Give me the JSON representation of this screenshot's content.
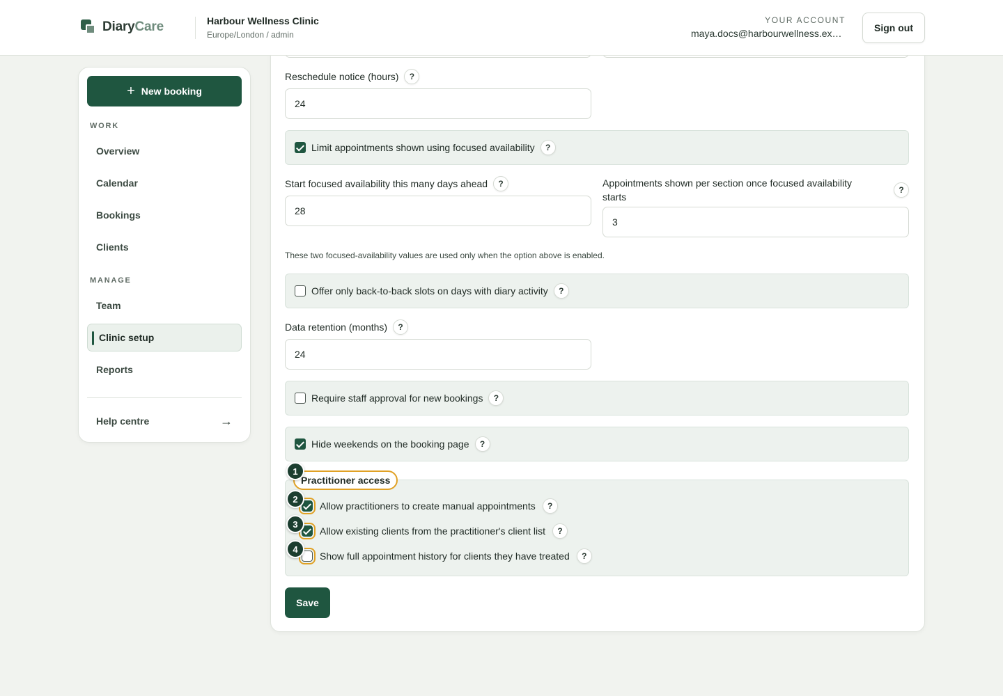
{
  "app": {
    "logo_primary": "Diary",
    "logo_secondary": "Care",
    "clinic_name": "Harbour Wellness Clinic",
    "clinic_sub": "Europe/London / admin"
  },
  "account": {
    "label": "YOUR ACCOUNT",
    "email": "maya.docs@harbourwellness.example",
    "signout_label": "Sign out"
  },
  "sidebar": {
    "new_booking_label": "New booking",
    "work_label": "WORK",
    "work_items": [
      "Overview",
      "Calendar",
      "Bookings",
      "Clients"
    ],
    "manage_label": "MANAGE",
    "manage_items": [
      "Team",
      "Clinic setup",
      "Reports"
    ],
    "active_item": "Clinic setup",
    "help_label": "Help centre"
  },
  "form": {
    "reschedule": {
      "label": "Reschedule notice (hours)",
      "value": "24"
    },
    "focused_toggle": {
      "label": "Limit appointments shown using focused availability",
      "checked": true
    },
    "days_ahead": {
      "label": "Start focused availability this many days ahead",
      "value": "28"
    },
    "per_section": {
      "label": "Appointments shown per section once focused availability starts",
      "value": "3"
    },
    "focused_note": "These two focused-availability values are used only when the option above is enabled.",
    "back_to_back": {
      "label": "Offer only back-to-back slots on days with diary activity",
      "checked": false
    },
    "retention": {
      "label": "Data retention (months)",
      "value": "24"
    },
    "approval": {
      "label": "Require staff approval for new bookings",
      "checked": false
    },
    "hide_weekends": {
      "label": "Hide weekends on the booking page",
      "checked": true
    },
    "practitioner_access": {
      "legend": "Practitioner access",
      "options": [
        {
          "label": "Allow practitioners to create manual appointments",
          "checked": true
        },
        {
          "label": "Allow existing clients from the practitioner's client list",
          "checked": true
        },
        {
          "label": "Show full appointment history for clients they have treated",
          "checked": false
        }
      ]
    },
    "help_glyph": "?",
    "save_label": "Save"
  },
  "markers": [
    "1",
    "2",
    "3",
    "4"
  ],
  "icons": {
    "logo": "diarycare-logo-icon",
    "plus": "plus-icon",
    "arrow": "arrow-right-icon",
    "help": "help-circle-icon",
    "check": "checkbox-icon"
  },
  "colors": {
    "brand": "#1f5640",
    "highlight": "#e0a125",
    "panel": "#edf2ee",
    "background": "#f1f3ef"
  }
}
